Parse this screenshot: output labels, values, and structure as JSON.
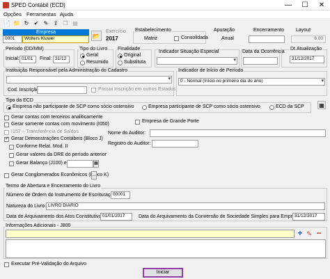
{
  "window": {
    "title": "SPED Contábil (ECD)",
    "min": "—",
    "max": "☐",
    "close": "✕"
  },
  "menu": [
    "Opções",
    "Ferramentas",
    "Ajuda"
  ],
  "empresa": {
    "header": "Empresa",
    "code": "0001",
    "name": "Wolters Kluwer"
  },
  "exercicio": {
    "label": "Exercício",
    "value": "2017"
  },
  "estabelecimento": {
    "label": "Estabelecimento",
    "value": "Matriz",
    "consolidada": "Consolidada"
  },
  "apuracao": {
    "label": "Apuração",
    "value": "Anual"
  },
  "encerramento": {
    "label": "Encerramento",
    "value": ""
  },
  "layout": {
    "label": "Layout",
    "value": "6.00"
  },
  "periodo": {
    "label": "Período (DD/MM)",
    "inicial_label": "Inicial:",
    "inicial": "01/01",
    "final_label": "Final:",
    "final": "31/12"
  },
  "tipo_livro": {
    "label": "Tipo do Livro",
    "geral": "Geral",
    "resumido": "Resumido"
  },
  "finalidade": {
    "label": "Finalidade",
    "original": "Original",
    "substituta": "Substituta"
  },
  "situacao": {
    "label": "Indicador Situação Especial",
    "value": ""
  },
  "data_ocorrencia": {
    "label": "Data da Ocorrência",
    "value": ""
  },
  "dt_atualizacao": {
    "label": "Dt.Atualização",
    "value": "31/12/2017"
  },
  "instituicao": {
    "label": "Instituição Responsável pela Administração do Cadastro",
    "value": "",
    "cod_label": "Cod. Inscrição",
    "cod_value": "",
    "possui": "Possui Inscrição em outros Estados"
  },
  "inicio_periodo": {
    "label": "Indicador de Início de Período",
    "value": "0 - Normal (Início no primeiro dia do ano)"
  },
  "tipo_ecd": {
    "label": "Tipo da ECD",
    "opt1": "Empresa não participante de SCP como sócio ostensivo",
    "opt2": "Empresa participante de SCP como sócio ostensivo",
    "opt3": "ECD da SCP"
  },
  "options": {
    "gerar_contas_tecnicamente": "Gerar contas com terceiros analiticamente",
    "gerar_somente_movimento": "Gerar somente contas com movimento (I050)",
    "i157": "I157 – Transferência de Saldos",
    "gerar_demonstracoes": "Gerar Demonstrações Contábeis (Bloco J)",
    "conforme_relat": "Conforme Relat. Mod. II",
    "gerar_valores_dre": "Gerar valores da DRE do período anterior",
    "gerar_balanco": "Gerar Balanço (J100) em",
    "balanco_value": "",
    "gerar_conglomerados": "Gerar Conglomerados Econômicos (Bloco K)",
    "empresa_grande_porte": "Empresa de Grande Porte",
    "nome_auditor": "Nome do Auditor:",
    "registro_auditor": "Registro do Auditor:"
  },
  "termo": {
    "label": "Termo de Abertura e Encerramento do Livro",
    "numero_label": "Número de Ordem do Instrumento de Escrituração:",
    "numero_value": "00001",
    "natureza_label": "Natureza do Livro:",
    "natureza_value": "LIVRO DIÁRIO",
    "data_arq_label": "Data do Arquivamento dos Atos Constitutivos:",
    "data_arq_value": "01/01/2017",
    "data_conv_label": "Data do Arquivamento da Conversão de Sociedade Simples para Empresária:",
    "data_conv_value": "31/12/2017"
  },
  "info_adicionais": {
    "label": "Informações Adicionais - J800"
  },
  "executar": "Executar Pré-Validação do Arquivo",
  "iniciar": "Iniciar",
  "colors": {
    "selection": "#0078d7",
    "highlight": "#ffffcc",
    "iniciar_border": "#8e3fa6"
  }
}
